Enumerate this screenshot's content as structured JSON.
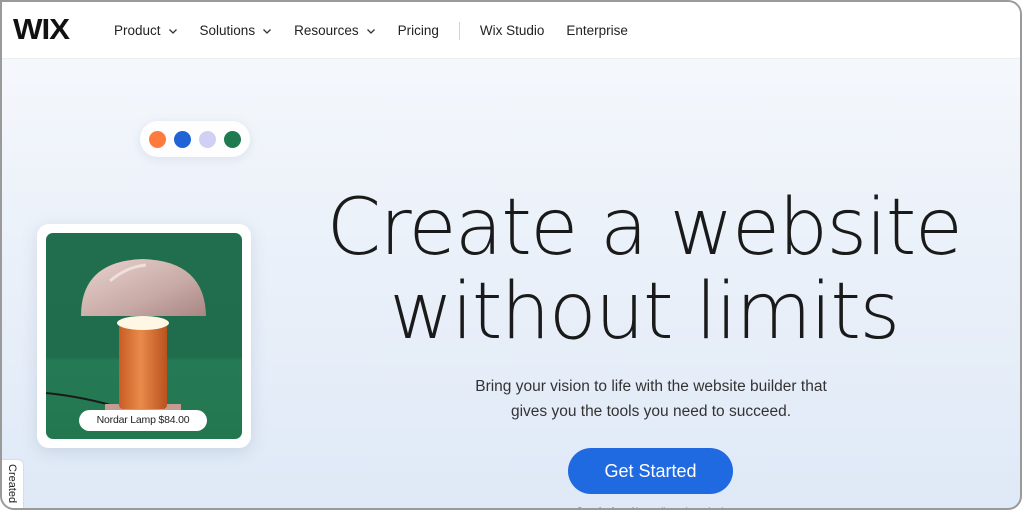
{
  "brand": {
    "logo_text": "WIX"
  },
  "nav": {
    "items": [
      {
        "label": "Product",
        "has_dropdown": true
      },
      {
        "label": "Solutions",
        "has_dropdown": true
      },
      {
        "label": "Resources",
        "has_dropdown": true
      },
      {
        "label": "Pricing",
        "has_dropdown": false
      },
      {
        "label": "Wix Studio",
        "has_dropdown": false
      },
      {
        "label": "Enterprise",
        "has_dropdown": false
      }
    ]
  },
  "color_swatches": {
    "colors": [
      "#ff7a3d",
      "#1f63d6",
      "#d0d0f5",
      "#1f7a4f"
    ]
  },
  "product_card": {
    "label": "Nordar Lamp $84.00",
    "name": "Nordar Lamp",
    "price": "$84.00"
  },
  "hero": {
    "headline_line1": "Create a website",
    "headline_line2": "without limits",
    "subtitle_line1": "Bring your vision to life with the website builder that",
    "subtitle_line2": "gives you the tools you need to succeed.",
    "cta_label": "Get Started",
    "cta_note": "Start for free. No credit card required"
  },
  "side_tab": {
    "label": "Created"
  },
  "theme": {
    "accent": "#1f6ae0",
    "card_background": "#206e4e"
  }
}
